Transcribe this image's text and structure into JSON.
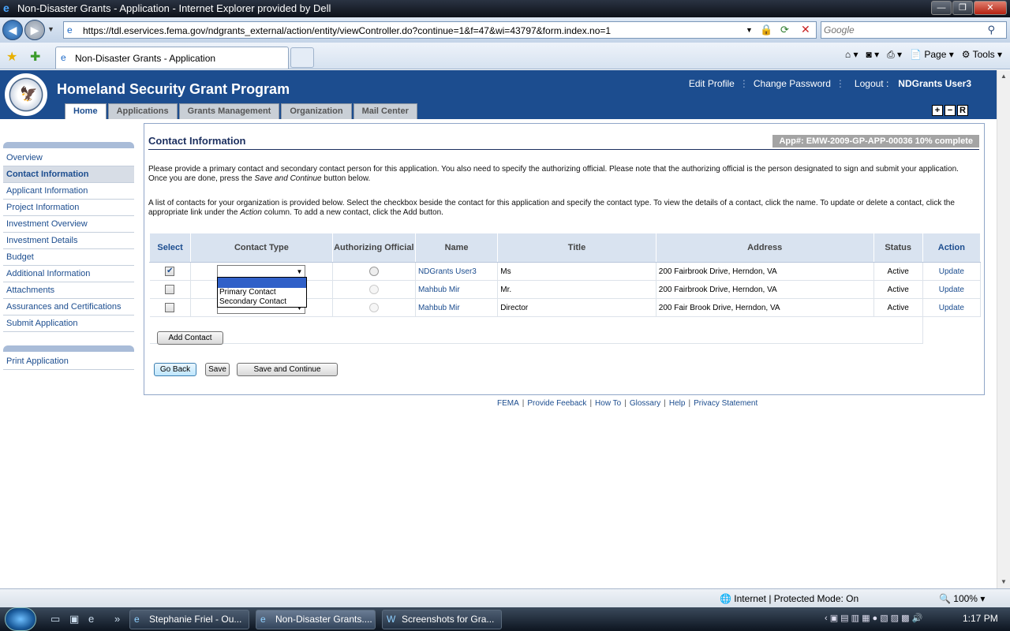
{
  "browser": {
    "window_title": "Non-Disaster Grants - Application - Internet Explorer provided by Dell",
    "url": "https://tdl.eservices.fema.gov/ndgrants_external/action/entity/viewController.do?continue=1&f=47&wi=43797&form.index.no=1",
    "search_placeholder": "Google",
    "tab_title": "Non-Disaster Grants - Application",
    "cmd_page": "Page",
    "cmd_tools": "Tools",
    "status_zone": "Internet | Protected Mode: On",
    "zoom": "100%"
  },
  "app": {
    "title": "Homeland Security Grant Program",
    "topnav": {
      "edit_profile": "Edit Profile",
      "change_password": "Change Password",
      "logout": "Logout :",
      "user": "NDGrants User3"
    },
    "tabs": [
      "Home",
      "Applications",
      "Grants Management",
      "Organization",
      "Mail Center"
    ],
    "header_controls": [
      "+",
      "−",
      "R"
    ]
  },
  "sidebar": {
    "items": [
      "Overview",
      "Contact Information",
      "Applicant Information",
      "Project Information",
      "Investment Overview",
      "Investment Details",
      "Budget",
      "Additional Information",
      "Attachments",
      "Assurances and Certifications",
      "Submit Application"
    ],
    "active_index": 1,
    "secondary": [
      "Print Application"
    ]
  },
  "main": {
    "heading": "Contact Information",
    "app_badge": "App#: EMW-2009-GP-APP-00036 10% complete",
    "para1_a": "Please provide a primary contact and secondary contact person for this application. You also need to specify the authorizing official. Please note that the authorizing official is the person designated to sign and submit your application. Once you are done, press the ",
    "para1_em": "Save and Continue",
    "para1_b": " button below.",
    "para2_a": "A list of contacts for your organization is provided below. Select the checkbox beside the contact for this application and specify the contact type. To view the details of a contact, click the name. To update or delete a contact, click the appropriate link under the ",
    "para2_em": "Action",
    "para2_b": " column. To add a new contact, click the Add button.",
    "table": {
      "headers": {
        "select": "Select",
        "contact_type": "Contact Type",
        "authorizing": "Authorizing Official",
        "name": "Name",
        "title": "Title",
        "address": "Address",
        "status": "Status",
        "action": "Action"
      },
      "rows": [
        {
          "checked": true,
          "name": "NDGrants User3",
          "title": "Ms",
          "address": "200 Fairbrook Drive, Herndon, VA",
          "status": "Active",
          "action": "Update"
        },
        {
          "checked": false,
          "name": "Mahbub Mir",
          "title": "Mr.",
          "address": "200 Fairbrook Drive, Herndon, VA",
          "status": "Active",
          "action": "Update"
        },
        {
          "checked": false,
          "name": "Mahbub Mir",
          "title": "Director",
          "address": "200 Fair Brook Drive, Herndon, VA",
          "status": "Active",
          "action": "Update"
        }
      ]
    },
    "dropdown_options": [
      "",
      "Primary Contact",
      "Secondary Contact"
    ],
    "buttons": {
      "add_contact": "Add Contact",
      "go_back": "Go Back",
      "save": "Save",
      "save_continue": "Save and Continue"
    }
  },
  "footer": {
    "links": [
      "FEMA",
      "Provide Feeback",
      "How To",
      "Glossary",
      "Help",
      "Privacy Statement"
    ]
  },
  "taskbar": {
    "buttons": [
      "Stephanie Friel - Ou...",
      "Non-Disaster Grants....",
      "Screenshots for Gra..."
    ],
    "clock": "1:17 PM"
  }
}
